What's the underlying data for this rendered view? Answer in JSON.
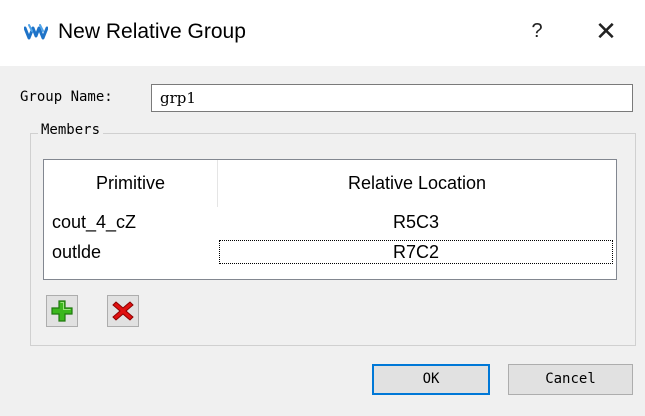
{
  "window": {
    "title": "New Relative Group",
    "help_label": "?",
    "close_label": "✕",
    "app_icon": "wave-logo-icon",
    "accent_color": "#0078d7"
  },
  "form": {
    "group_name_label": "Group Name:",
    "group_name_value": "grp1"
  },
  "members": {
    "legend": "Members",
    "columns": [
      "Primitive",
      "Relative Location"
    ],
    "rows": [
      {
        "primitive": "cout_4_cZ",
        "location": "R5C3"
      },
      {
        "primitive": "outlde",
        "location": "R7C2"
      }
    ],
    "add_icon": "plus-icon",
    "remove_icon": "x-icon"
  },
  "buttons": {
    "ok": "OK",
    "cancel": "Cancel"
  }
}
